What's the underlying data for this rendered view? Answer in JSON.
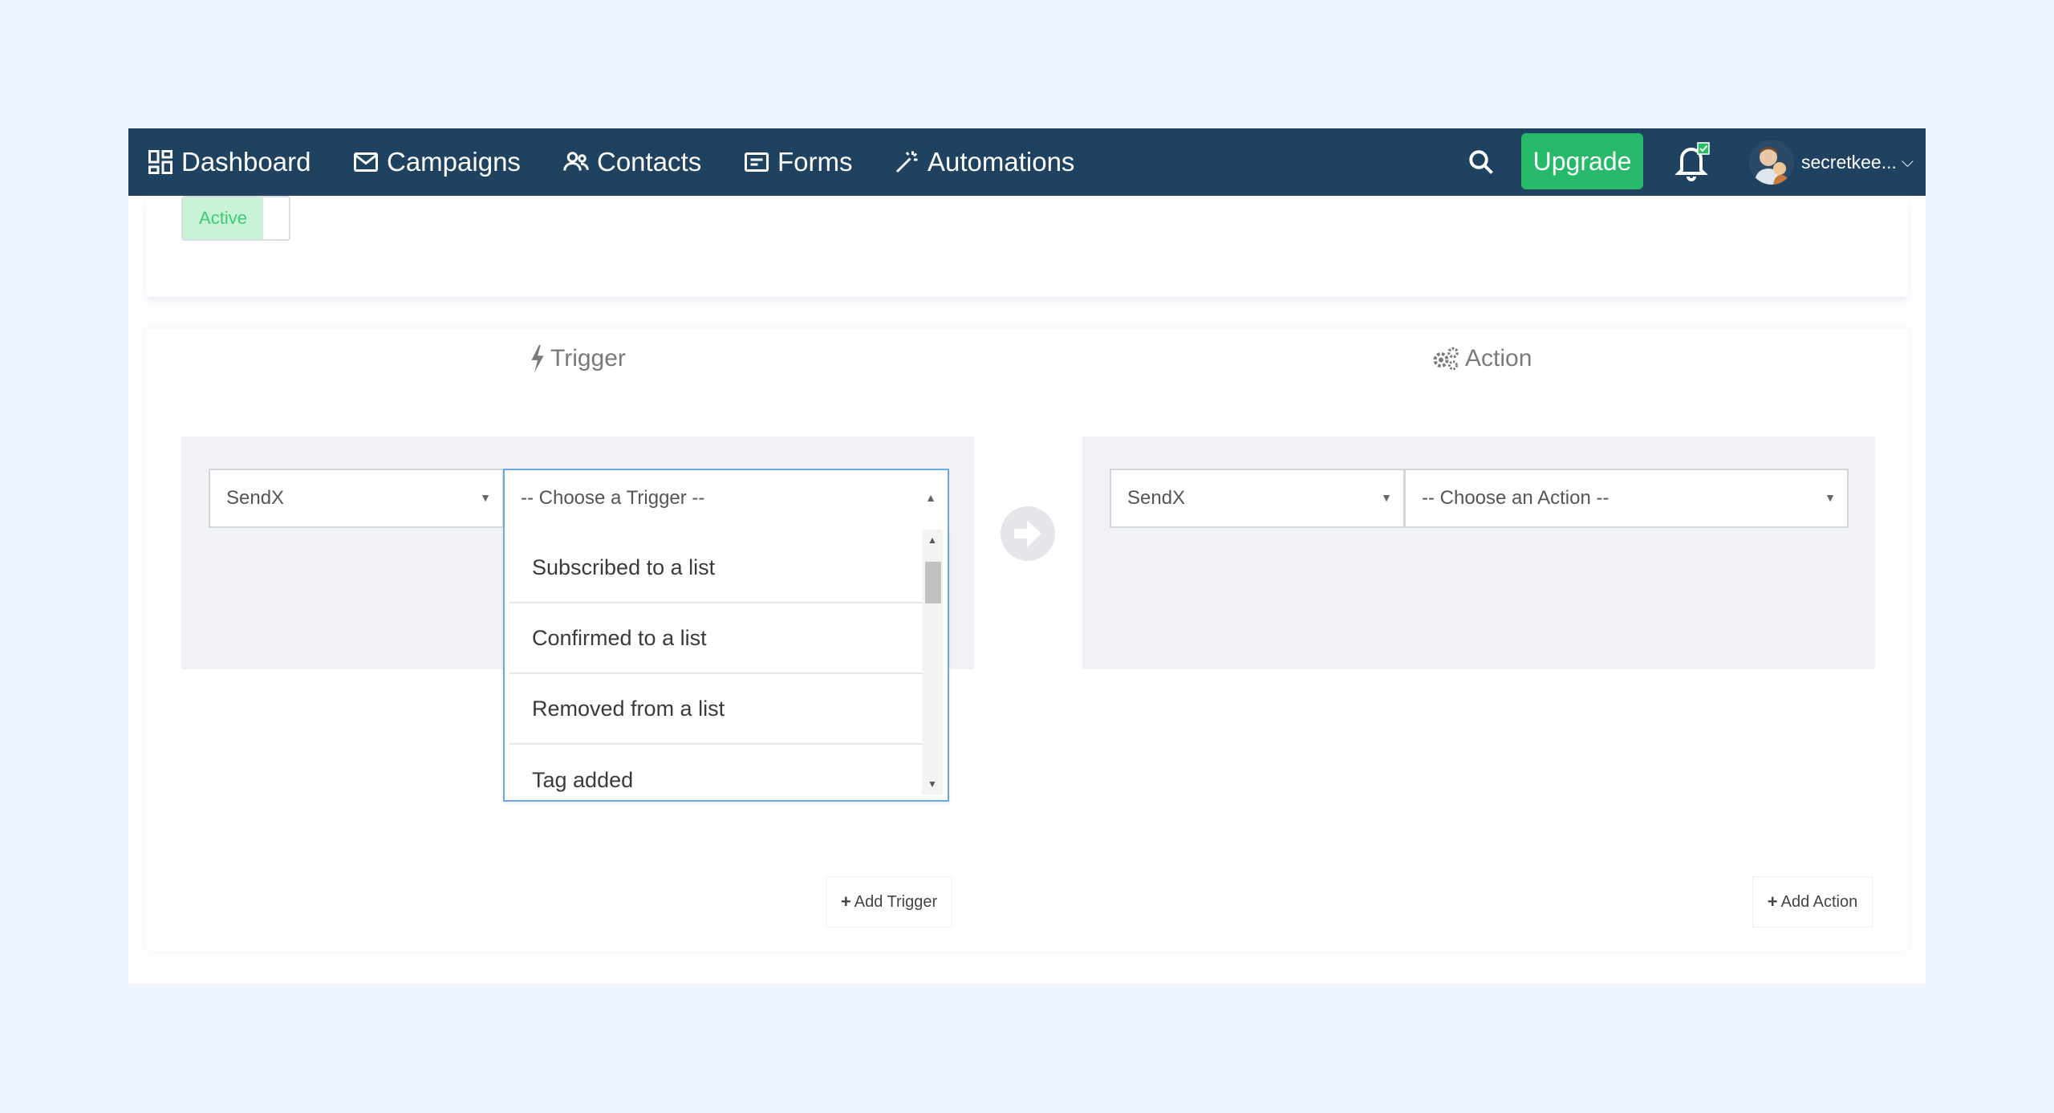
{
  "nav": {
    "items": [
      {
        "label": "Dashboard",
        "icon": "dashboard-icon"
      },
      {
        "label": "Campaigns",
        "icon": "mail-icon"
      },
      {
        "label": "Contacts",
        "icon": "users-icon"
      },
      {
        "label": "Forms",
        "icon": "form-icon"
      },
      {
        "label": "Automations",
        "icon": "magic-wand-icon"
      }
    ],
    "upgrade_label": "Upgrade",
    "user_name": "secretkee...",
    "user_chevron": "⌵"
  },
  "status": {
    "toggle_label": "Active"
  },
  "trigger": {
    "title": "Trigger",
    "app_select": "SendX",
    "choose_select": "-- Choose a Trigger --",
    "options": [
      "Subscribed to a list",
      "Confirmed to a list",
      "Removed from a list",
      "Tag added"
    ],
    "add_label": "Add Trigger"
  },
  "action": {
    "title": "Action",
    "app_select": "SendX",
    "choose_select": "-- Choose an Action --",
    "add_label": "Add Action"
  },
  "colors": {
    "navbar": "#1f4261",
    "upgrade": "#26b96a",
    "active_bg": "#c8f3d6",
    "active_text": "#3dcc75",
    "focus_border": "#6aa8e8"
  }
}
